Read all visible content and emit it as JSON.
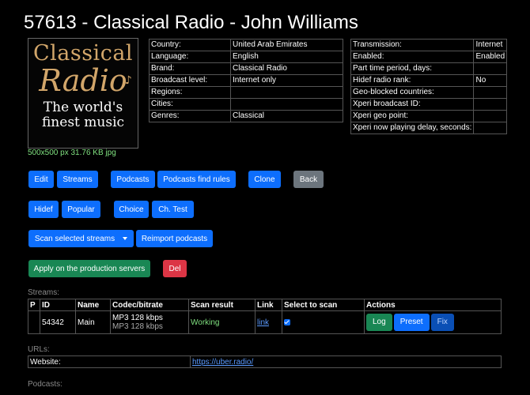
{
  "page_title": "57613 - Classical Radio - John Williams",
  "logo": {
    "line1": "Classical",
    "line2": "Radio",
    "line3": "The world's finest music"
  },
  "image_info": "500x500 px 31.76 KB jpg",
  "info_left": [
    {
      "key": "Country:",
      "value": "United Arab Emirates"
    },
    {
      "key": "Language:",
      "value": "English"
    },
    {
      "key": "Brand:",
      "value": "Classical Radio"
    },
    {
      "key": "Broadcast level:",
      "value": "Internet only"
    },
    {
      "key": "Regions:",
      "value": ""
    },
    {
      "key": "Cities:",
      "value": ""
    },
    {
      "key": "Genres:",
      "value": "Classical"
    }
  ],
  "info_right": [
    {
      "key": "Transmission:",
      "value": "Internet"
    },
    {
      "key": "Enabled:",
      "value": "Enabled"
    },
    {
      "key": "Part time period, days:",
      "value": ""
    },
    {
      "key": "Hidef radio rank:",
      "value": "No"
    },
    {
      "key": "Geo-blocked countries:",
      "value": ""
    },
    {
      "key": "Xperi broadcast ID:",
      "value": ""
    },
    {
      "key": "Xperi geo point:",
      "value": ""
    },
    {
      "key": "Xperi now playing delay, seconds:",
      "value": ""
    }
  ],
  "buttons": {
    "edit": "Edit",
    "streams": "Streams",
    "podcasts": "Podcasts",
    "podcasts_find_rules": "Podcasts find rules",
    "clone": "Clone",
    "back": "Back",
    "hidef": "Hidef",
    "popular": "Popular",
    "choice": "Choice",
    "ch_test": "Ch. Test",
    "scan_selected": "Scan selected streams",
    "reimport": "Reimport podcasts",
    "apply": "Apply on the production servers",
    "del": "Del"
  },
  "streams_section": {
    "label": "Streams:",
    "headers": [
      "P",
      "ID",
      "Name",
      "Codec/bitrate",
      "Scan result",
      "Link",
      "Select to scan",
      "Actions"
    ],
    "rows": [
      {
        "p": "",
        "id": "54342",
        "name": "Main",
        "codec": "MP3 128 kbps",
        "codec_sub": "MP3 128 kbps",
        "scan": "Working",
        "link": "link",
        "selected": true,
        "actions": {
          "log": "Log",
          "preset": "Preset",
          "fix": "Fix"
        }
      }
    ]
  },
  "urls_section": {
    "label": "URLs:",
    "key": "Website:",
    "value": "https://uber.radio/"
  },
  "podcasts_section": {
    "label": "Podcasts:"
  }
}
